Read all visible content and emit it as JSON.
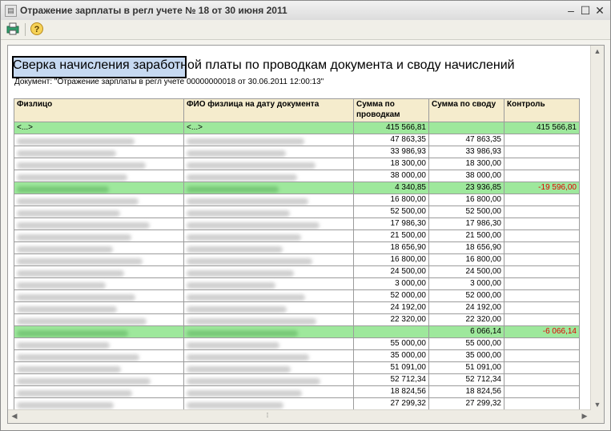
{
  "window": {
    "title": "Отражение зарплаты в регл учете № 18 от 30 июня 2011"
  },
  "report": {
    "title": "Сверка начисления заработной платы по проводкам документа и своду начислений",
    "subtitle": "Документ: \"Отражение зарплаты в регл учете 00000000018 от 30.06.2011 12:00:13\""
  },
  "table": {
    "headers": [
      "Физлицо",
      "ФИО физлица на дату документа",
      "Сумма по проводкам",
      "Сумма по своду",
      "Контроль"
    ],
    "rows": [
      {
        "c1": "<...>",
        "c2": "<...>",
        "prov": "415 566,81",
        "svod": "",
        "ctrl": "415 566,81",
        "green": true,
        "blurred": false
      },
      {
        "prov": "47 863,35",
        "svod": "47 863,35",
        "ctrl": "",
        "green": false,
        "blurred": true
      },
      {
        "prov": "33 986,93",
        "svod": "33 986,93",
        "ctrl": "",
        "green": false,
        "blurred": true
      },
      {
        "prov": "18 300,00",
        "svod": "18 300,00",
        "ctrl": "",
        "green": false,
        "blurred": true
      },
      {
        "prov": "38 000,00",
        "svod": "38 000,00",
        "ctrl": "",
        "green": false,
        "blurred": true
      },
      {
        "prov": "4 340,85",
        "svod": "23 936,85",
        "ctrl": "-19 596,00",
        "green": true,
        "blurred": true
      },
      {
        "prov": "16 800,00",
        "svod": "16 800,00",
        "ctrl": "",
        "green": false,
        "blurred": true
      },
      {
        "prov": "52 500,00",
        "svod": "52 500,00",
        "ctrl": "",
        "green": false,
        "blurred": true
      },
      {
        "prov": "17 986,30",
        "svod": "17 986,30",
        "ctrl": "",
        "green": false,
        "blurred": true
      },
      {
        "prov": "21 500,00",
        "svod": "21 500,00",
        "ctrl": "",
        "green": false,
        "blurred": true
      },
      {
        "prov": "18 656,90",
        "svod": "18 656,90",
        "ctrl": "",
        "green": false,
        "blurred": true
      },
      {
        "prov": "16 800,00",
        "svod": "16 800,00",
        "ctrl": "",
        "green": false,
        "blurred": true
      },
      {
        "prov": "24 500,00",
        "svod": "24 500,00",
        "ctrl": "",
        "green": false,
        "blurred": true
      },
      {
        "prov": "3 000,00",
        "svod": "3 000,00",
        "ctrl": "",
        "green": false,
        "blurred": true
      },
      {
        "prov": "52 000,00",
        "svod": "52 000,00",
        "ctrl": "",
        "green": false,
        "blurred": true
      },
      {
        "prov": "24 192,00",
        "svod": "24 192,00",
        "ctrl": "",
        "green": false,
        "blurred": true
      },
      {
        "prov": "22 320,00",
        "svod": "22 320,00",
        "ctrl": "",
        "green": false,
        "blurred": true
      },
      {
        "prov": "",
        "svod": "6 066,14",
        "ctrl": "-6 066,14",
        "green": true,
        "blurred": true
      },
      {
        "prov": "55 000,00",
        "svod": "55 000,00",
        "ctrl": "",
        "green": false,
        "blurred": true
      },
      {
        "prov": "35 000,00",
        "svod": "35 000,00",
        "ctrl": "",
        "green": false,
        "blurred": true
      },
      {
        "prov": "51 091,00",
        "svod": "51 091,00",
        "ctrl": "",
        "green": false,
        "blurred": true
      },
      {
        "prov": "52 712,34",
        "svod": "52 712,34",
        "ctrl": "",
        "green": false,
        "blurred": true
      },
      {
        "prov": "18 824,56",
        "svod": "18 824,56",
        "ctrl": "",
        "green": false,
        "blurred": true
      },
      {
        "prov": "27 299,32",
        "svod": "27 299,32",
        "ctrl": "",
        "green": false,
        "blurred": true
      }
    ]
  },
  "icons": {
    "titlebar": "document-icon",
    "toolbar": [
      "print-icon",
      "help-icon"
    ],
    "window_controls": [
      "minimize-icon",
      "maximize-icon",
      "close-icon"
    ]
  },
  "colors": {
    "header_bg": "#f5eccd",
    "highlight_row": "#9ee89c",
    "negative": "#e00000",
    "selection": "#c6d9f1"
  }
}
